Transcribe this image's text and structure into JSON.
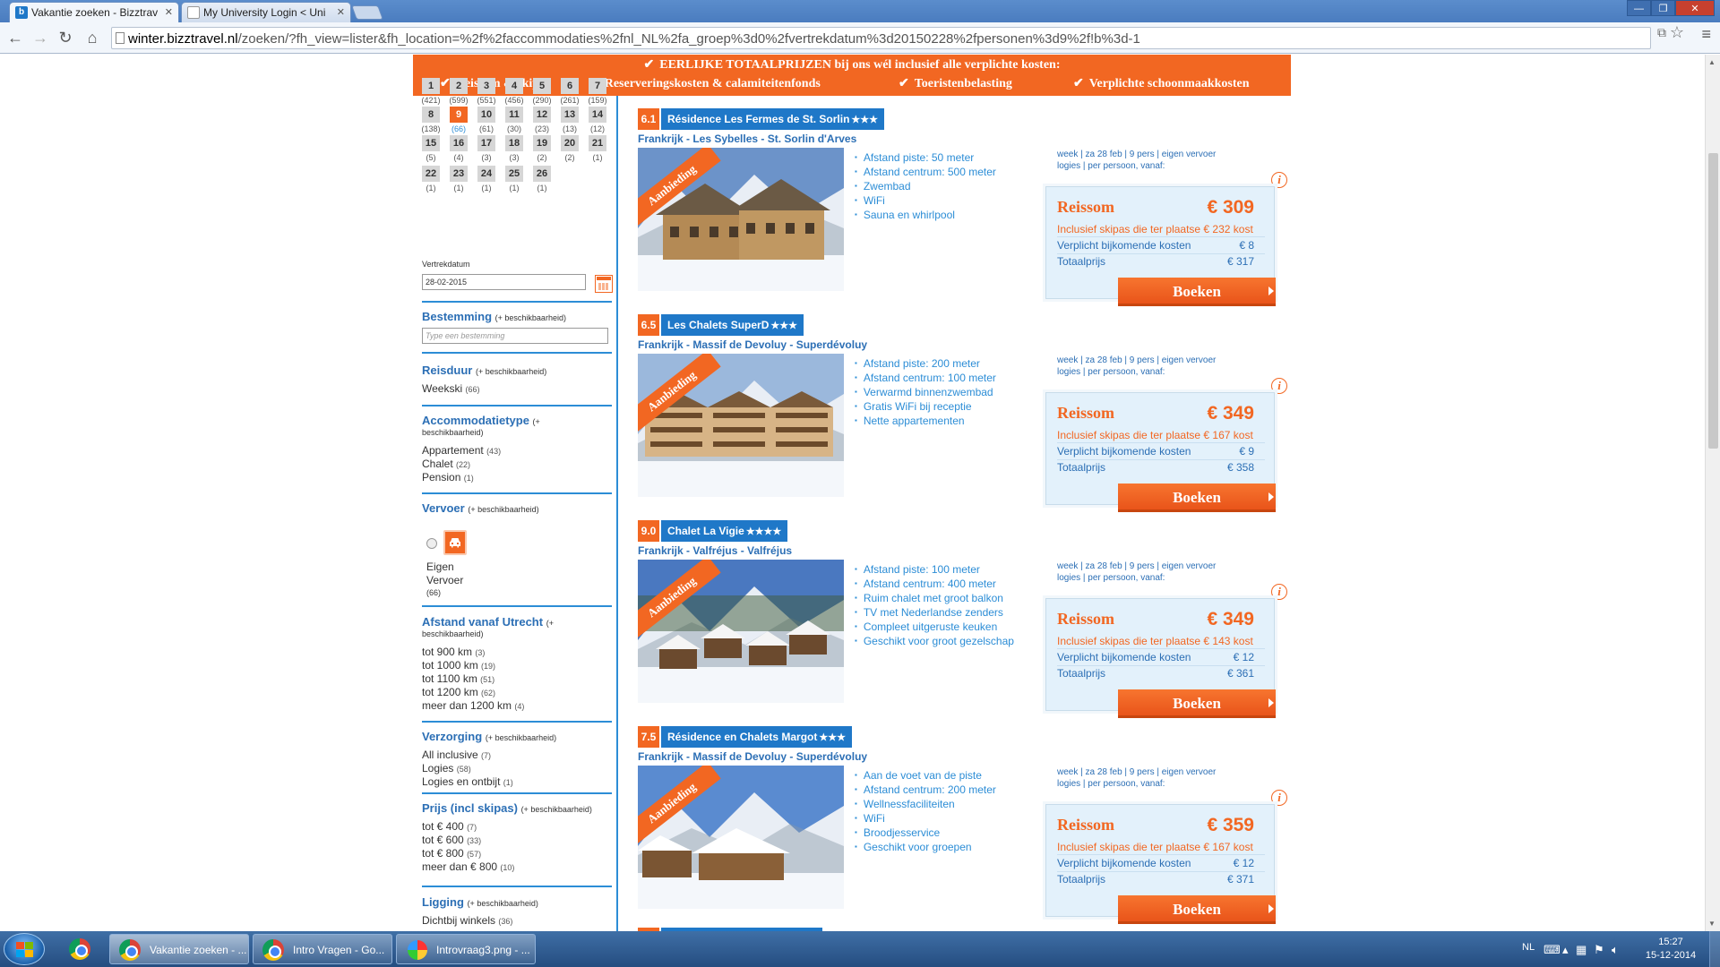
{
  "browser": {
    "tabs": [
      {
        "label": "Vakantie zoeken - Bizztrav",
        "favicon": "b"
      },
      {
        "label": "My University Login < Uni",
        "favicon": ""
      }
    ],
    "url_host": "winter.bizztravel.nl",
    "url_path": "/zoeken/?fh_view=lister&fh_location=%2f%2faccommodaties%2fnl_NL%2fa_groep%3d0%2fvertrekdatum%3d20150228%2fpersonen%3d9%2f!b%3d-1"
  },
  "banner": {
    "title": "EERLIJKE TOTAALPRIJZEN bij ons wél inclusief alle verplichte kosten:",
    "items": [
      "Reissom & skipas",
      "Reserveringskosten & calamiteitenfonds",
      "Toeristenbelasting",
      "Verplichte schoonmaakkosten"
    ]
  },
  "sidebar": {
    "days": [
      {
        "n": "1",
        "c": "(421)"
      },
      {
        "n": "2",
        "c": "(599)"
      },
      {
        "n": "3",
        "c": "(551)"
      },
      {
        "n": "4",
        "c": "(456)"
      },
      {
        "n": "5",
        "c": "(290)"
      },
      {
        "n": "6",
        "c": "(261)"
      },
      {
        "n": "7",
        "c": "(159)"
      },
      {
        "n": "8",
        "c": "(138)"
      },
      {
        "n": "9",
        "c": "(66)"
      },
      {
        "n": "10",
        "c": "(61)"
      },
      {
        "n": "11",
        "c": "(30)"
      },
      {
        "n": "12",
        "c": "(23)"
      },
      {
        "n": "13",
        "c": "(13)"
      },
      {
        "n": "14",
        "c": "(12)"
      },
      {
        "n": "15",
        "c": "(5)"
      },
      {
        "n": "16",
        "c": "(4)"
      },
      {
        "n": "17",
        "c": "(3)"
      },
      {
        "n": "18",
        "c": "(3)"
      },
      {
        "n": "19",
        "c": "(2)"
      },
      {
        "n": "20",
        "c": "(2)"
      },
      {
        "n": "21",
        "c": "(1)"
      },
      {
        "n": "22",
        "c": "(1)"
      },
      {
        "n": "23",
        "c": "(1)"
      },
      {
        "n": "24",
        "c": "(1)"
      },
      {
        "n": "25",
        "c": "(1)"
      },
      {
        "n": "26",
        "c": "(1)"
      }
    ],
    "selected_day": "9",
    "vertrekdatum_label": "Vertrekdatum",
    "vertrekdatum_value": "28-02-2015",
    "avail": "(+ beschikbaarheid)",
    "bestemming": {
      "title": "Bestemming",
      "placeholder": "Type een bestemming"
    },
    "reisduur": {
      "title": "Reisduur",
      "options": [
        {
          "label": "Weekski",
          "count": "(66)"
        }
      ]
    },
    "accommodatietype": {
      "title": "Accommodatietype",
      "avail_a": "(+",
      "avail_b": "beschikbaarheid)",
      "options": [
        {
          "label": "Appartement",
          "count": "(43)"
        },
        {
          "label": "Chalet",
          "count": "(22)"
        },
        {
          "label": "Pension",
          "count": "(1)"
        }
      ]
    },
    "vervoer": {
      "title": "Vervoer",
      "option_line1": "Eigen",
      "option_line2": "Vervoer",
      "option_count": "(66)"
    },
    "afstand": {
      "title": "Afstand vanaf Utrecht",
      "avail_a": "(+",
      "avail_b": "beschikbaarheid)",
      "options": [
        {
          "label": "tot 900 km",
          "count": "(3)"
        },
        {
          "label": "tot 1000 km",
          "count": "(19)"
        },
        {
          "label": "tot 1100 km",
          "count": "(51)"
        },
        {
          "label": "tot 1200 km",
          "count": "(62)"
        },
        {
          "label": "meer dan 1200 km",
          "count": "(4)"
        }
      ]
    },
    "verzorging": {
      "title": "Verzorging",
      "options": [
        {
          "label": "All inclusive",
          "count": "(7)"
        },
        {
          "label": "Logies",
          "count": "(58)"
        },
        {
          "label": "Logies en ontbijt",
          "count": "(1)"
        }
      ]
    },
    "prijs": {
      "title": "Prijs (incl skipas)",
      "options": [
        {
          "label": "tot € 400",
          "count": "(7)"
        },
        {
          "label": "tot € 600",
          "count": "(33)"
        },
        {
          "label": "tot € 800",
          "count": "(57)"
        },
        {
          "label": "meer dan € 800",
          "count": "(10)"
        }
      ]
    },
    "ligging": {
      "title": "Ligging",
      "options": [
        {
          "label": "Dichtbij winkels",
          "count": "(36)"
        }
      ]
    }
  },
  "listing_common": {
    "ribbon": "Aanbieding",
    "meta_line1": "week | za 28 feb | 9 pers | eigen vervoer",
    "meta_line2": "logies | per persoon, vanaf:",
    "price_title": "Reissom",
    "fees_label": "Verplicht bijkomende kosten",
    "total_label": "Totaalprijs",
    "book_label": "Boeken"
  },
  "listings": [
    {
      "score": "6.1",
      "name": "Résidence Les Fermes de St. Sorlin",
      "stars": "★★★",
      "location": "Frankrijk - Les Sybelles - St. Sorlin d'Arves",
      "features": [
        "Afstand piste: 50 meter",
        "Afstand centrum: 500 meter",
        "Zwembad",
        "WiFi",
        "Sauna en whirlpool"
      ],
      "price": "€ 309",
      "skipas": "Inclusief skipas die ter plaatse € 232 kost",
      "fees": "€ 8",
      "total": "€ 317"
    },
    {
      "score": "6.5",
      "name": "Les Chalets SuperD",
      "stars": "★★★",
      "location": "Frankrijk - Massif de Devoluy - Superdévoluy",
      "features": [
        "Afstand piste: 200 meter",
        "Afstand centrum: 100 meter",
        "Verwarmd binnenzwembad",
        "Gratis WiFi bij receptie",
        "Nette appartementen"
      ],
      "price": "€ 349",
      "skipas": "Inclusief skipas die ter plaatse € 167 kost",
      "fees": "€ 9",
      "total": "€ 358"
    },
    {
      "score": "9.0",
      "name": "Chalet La Vigie",
      "stars": "★★★★",
      "location": "Frankrijk - Valfréjus - Valfréjus",
      "features": [
        "Afstand piste: 100 meter",
        "Afstand centrum: 400 meter",
        "Ruim chalet met groot balkon",
        "TV met Nederlandse zenders",
        "Compleet uitgeruste keuken",
        "Geschikt voor groot gezelschap"
      ],
      "price": "€ 349",
      "skipas": "Inclusief skipas die ter plaatse € 143 kost",
      "fees": "€ 12",
      "total": "€ 361"
    },
    {
      "score": "7.5",
      "name": "Résidence en Chalets Margot",
      "stars": "★★★",
      "location": "Frankrijk - Massif de Devoluy - Superdévoluy",
      "features": [
        "Aan de voet van de piste",
        "Afstand centrum: 200 meter",
        "Wellnessfaciliteiten",
        "WiFi",
        "Broodjesservice",
        "Geschikt voor groepen"
      ],
      "price": "€ 359",
      "skipas": "Inclusief skipas die ter plaatse € 167 kost",
      "fees": "€ 12",
      "total": "€ 371"
    }
  ],
  "taskbar": {
    "tasks": [
      "Vakantie zoeken - ...",
      "Intro Vragen - Go...",
      "Introvraag3.png - ..."
    ],
    "lang": "NL",
    "time": "15:27",
    "date": "15-12-2014"
  },
  "colors": {
    "accent": "#f26722",
    "brand_blue": "#1f78c8",
    "link_blue": "#2c6fb5"
  }
}
